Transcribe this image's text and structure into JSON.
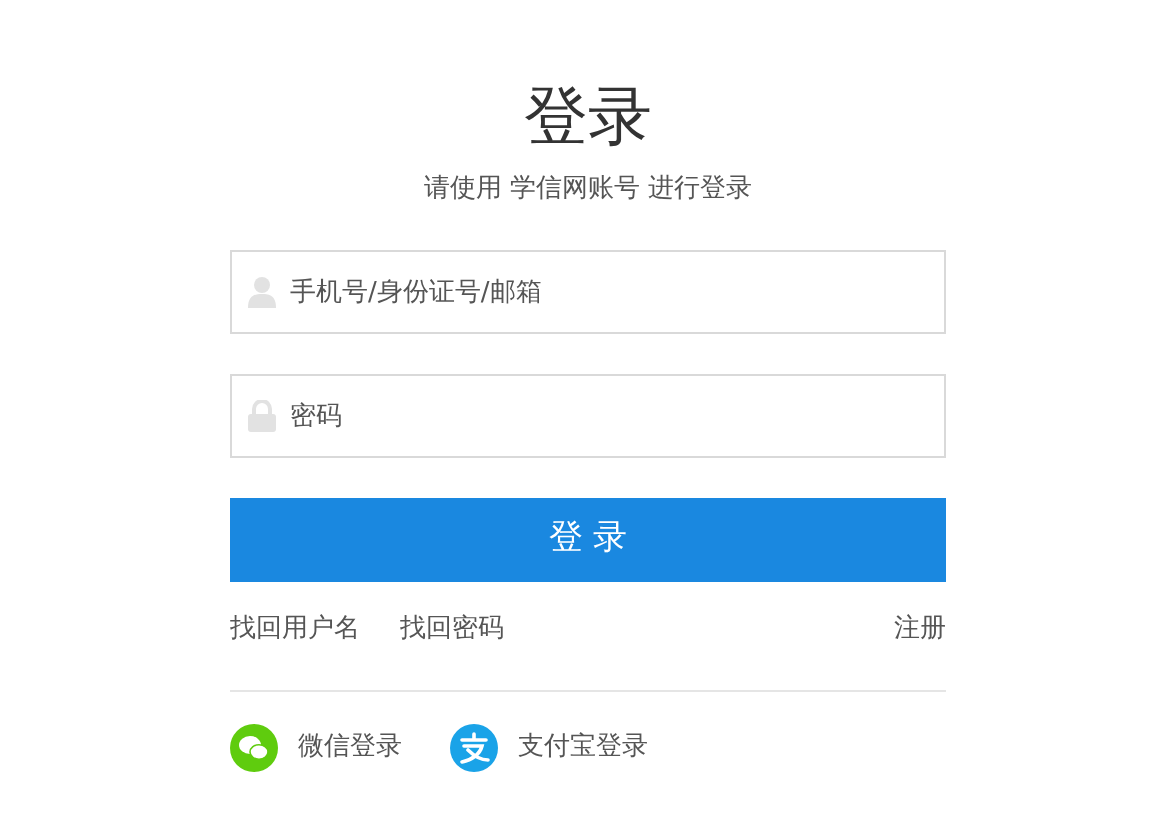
{
  "title": "登录",
  "subtitle": "请使用 学信网账号 进行登录",
  "fields": [
    {
      "kind": "user",
      "placeholder": "手机号/身份证号/邮箱"
    },
    {
      "kind": "lock",
      "placeholder": "密码"
    }
  ],
  "submit": "登 录",
  "links": [
    "找回用户名",
    "找回密码"
  ],
  "register": "注册",
  "social": [
    {
      "kind": "wechat",
      "label": "微信登录"
    },
    {
      "kind": "alipay",
      "label": "支付宝登录"
    }
  ]
}
